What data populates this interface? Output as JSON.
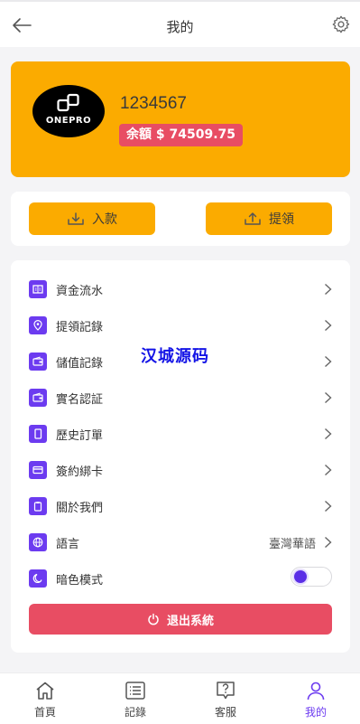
{
  "header": {
    "title": "我的"
  },
  "profile": {
    "logo_text": "ONEPRO",
    "username": "1234567",
    "balance_label": "余額 $",
    "balance_value": "74509.75"
  },
  "actions": {
    "deposit_label": "入款",
    "withdraw_label": "提領"
  },
  "menu": {
    "items": [
      {
        "label": "資金流水",
        "icon": "ledger-icon"
      },
      {
        "label": "提領記錄",
        "icon": "location-pin-icon"
      },
      {
        "label": "儲值記錄",
        "icon": "wallet-icon"
      },
      {
        "label": "實名認証",
        "icon": "id-card-icon"
      },
      {
        "label": "歷史訂單",
        "icon": "order-icon"
      },
      {
        "label": "簽約綁卡",
        "icon": "credit-card-icon"
      },
      {
        "label": "關於我們",
        "icon": "clipboard-icon"
      },
      {
        "label": "語言",
        "value": "臺灣華語",
        "icon": "globe-icon"
      },
      {
        "label": "暗色模式",
        "icon": "moon-icon",
        "toggle_on": false
      }
    ],
    "logout_label": "退出系統"
  },
  "watermark": "汉城源码",
  "tabbar": {
    "tabs": [
      {
        "label": "首頁",
        "icon": "home-icon"
      },
      {
        "label": "記錄",
        "icon": "list-icon"
      },
      {
        "label": "客服",
        "icon": "help-chat-icon"
      },
      {
        "label": "我的",
        "icon": "user-icon",
        "active": true
      }
    ]
  },
  "colors": {
    "accent": "#fbab00",
    "danger": "#e84d63",
    "purple": "#6c3bf0",
    "background": "#f4f4f6"
  }
}
